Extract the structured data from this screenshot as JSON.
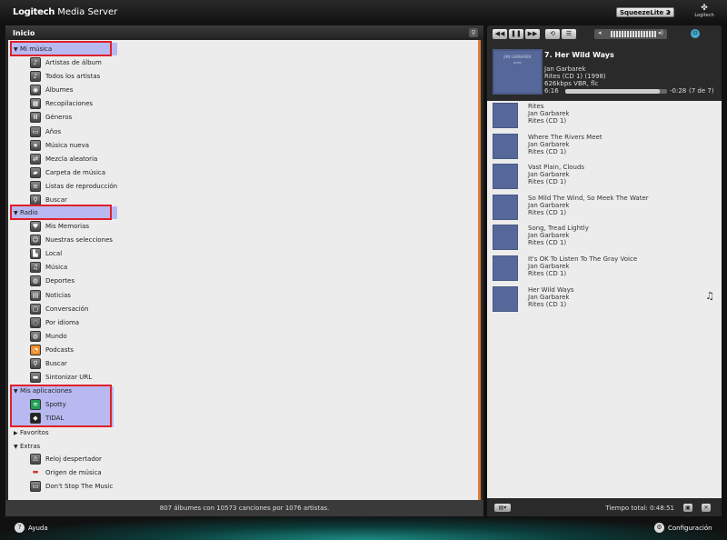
{
  "app": {
    "brand_bold": "Logitech",
    "brand_rest": " Media Server",
    "player": "SqueezeLite 2",
    "logo_text": "Logitech"
  },
  "left": {
    "header": "Inicio",
    "footer": "807 álbumes con 10573 canciones por 1076 artistas.",
    "sections": {
      "mi_musica": "Mi música",
      "radio": "Radio",
      "mis_aplicaciones": "Mis aplicaciones",
      "favoritos": "Favoritos",
      "extras": "Extras"
    },
    "mi_musica_items": [
      {
        "label": "Artistas de álbum",
        "icon": "artist-icon"
      },
      {
        "label": "Todos los artistas",
        "icon": "artist-icon"
      },
      {
        "label": "Álbumes",
        "icon": "album-icon"
      },
      {
        "label": "Recopilaciones",
        "icon": "compilation-icon"
      },
      {
        "label": "Géneros",
        "icon": "genre-icon"
      },
      {
        "label": "Años",
        "icon": "year-icon"
      },
      {
        "label": "Música nueva",
        "icon": "new-music-icon"
      },
      {
        "label": "Mezcla aleatoria",
        "icon": "shuffle-icon"
      },
      {
        "label": "Carpeta de música",
        "icon": "folder-icon"
      },
      {
        "label": "Listas de reproducción",
        "icon": "playlist-icon"
      },
      {
        "label": "Buscar",
        "icon": "search-icon"
      }
    ],
    "radio_items": [
      {
        "label": "Mis Memorias",
        "icon": "heart-icon"
      },
      {
        "label": "Nuestras selecciones",
        "icon": "people-icon"
      },
      {
        "label": "Local",
        "icon": "local-icon"
      },
      {
        "label": "Música",
        "icon": "music-icon"
      },
      {
        "label": "Deportes",
        "icon": "sports-icon"
      },
      {
        "label": "Noticias",
        "icon": "news-icon"
      },
      {
        "label": "Conversación",
        "icon": "talk-icon"
      },
      {
        "label": "Por idioma",
        "icon": "language-icon"
      },
      {
        "label": "Mundo",
        "icon": "globe-icon"
      },
      {
        "label": "Podcasts",
        "icon": "rss-icon"
      },
      {
        "label": "Buscar",
        "icon": "search-icon"
      },
      {
        "label": "Sintonizar URL",
        "icon": "tune-url-icon"
      }
    ],
    "apps_items": [
      {
        "label": "Spotty",
        "icon": "spotify-icon"
      },
      {
        "label": "TIDAL",
        "icon": "tidal-icon"
      }
    ],
    "extras_items": [
      {
        "label": "Reloj despertador",
        "icon": "alarm-icon"
      },
      {
        "label": "Origen de música",
        "icon": "source-icon"
      },
      {
        "label": "Don't Stop The Music",
        "icon": "dstm-icon"
      }
    ]
  },
  "now_playing": {
    "title": "7. Her Wild Ways",
    "artist": "Jan Garbarek",
    "album": "Rites (CD 1) (1998)",
    "format": "626kbps VBR, flc",
    "elapsed": "6:16",
    "remaining": "-0:28",
    "position": "(7 de 7)",
    "progress": 0.93,
    "cover_text": "JAN GARBAREK",
    "cover_sub": "RITES"
  },
  "playlist": [
    {
      "title": "Rites",
      "artist": "Jan Garbarek",
      "album": "Rites (CD 1)"
    },
    {
      "title": "Where The Rivers Meet",
      "artist": "Jan Garbarek",
      "album": "Rites (CD 1)"
    },
    {
      "title": "Vast Plain, Clouds",
      "artist": "Jan Garbarek",
      "album": "Rites (CD 1)"
    },
    {
      "title": "So Mild The Wind, So Meek The Water",
      "artist": "Jan Garbarek",
      "album": "Rites (CD 1)"
    },
    {
      "title": "Song, Tread Lightly",
      "artist": "Jan Garbarek",
      "album": "Rites (CD 1)"
    },
    {
      "title": "It's OK To Listen To The Gray Voice",
      "artist": "Jan Garbarek",
      "album": "Rites (CD 1)"
    },
    {
      "title": "Her Wild Ways",
      "artist": "Jan Garbarek",
      "album": "Rites (CD 1)",
      "playing": true
    }
  ],
  "right_footer": {
    "total": "Tiempo total: 0:48:51"
  },
  "bottom": {
    "help": "Ayuda",
    "settings": "Configuración"
  },
  "colors": {
    "highlight": "#b9b9f2",
    "annotation_box": "#e0202a",
    "scrollbar": "#e07a3a"
  }
}
